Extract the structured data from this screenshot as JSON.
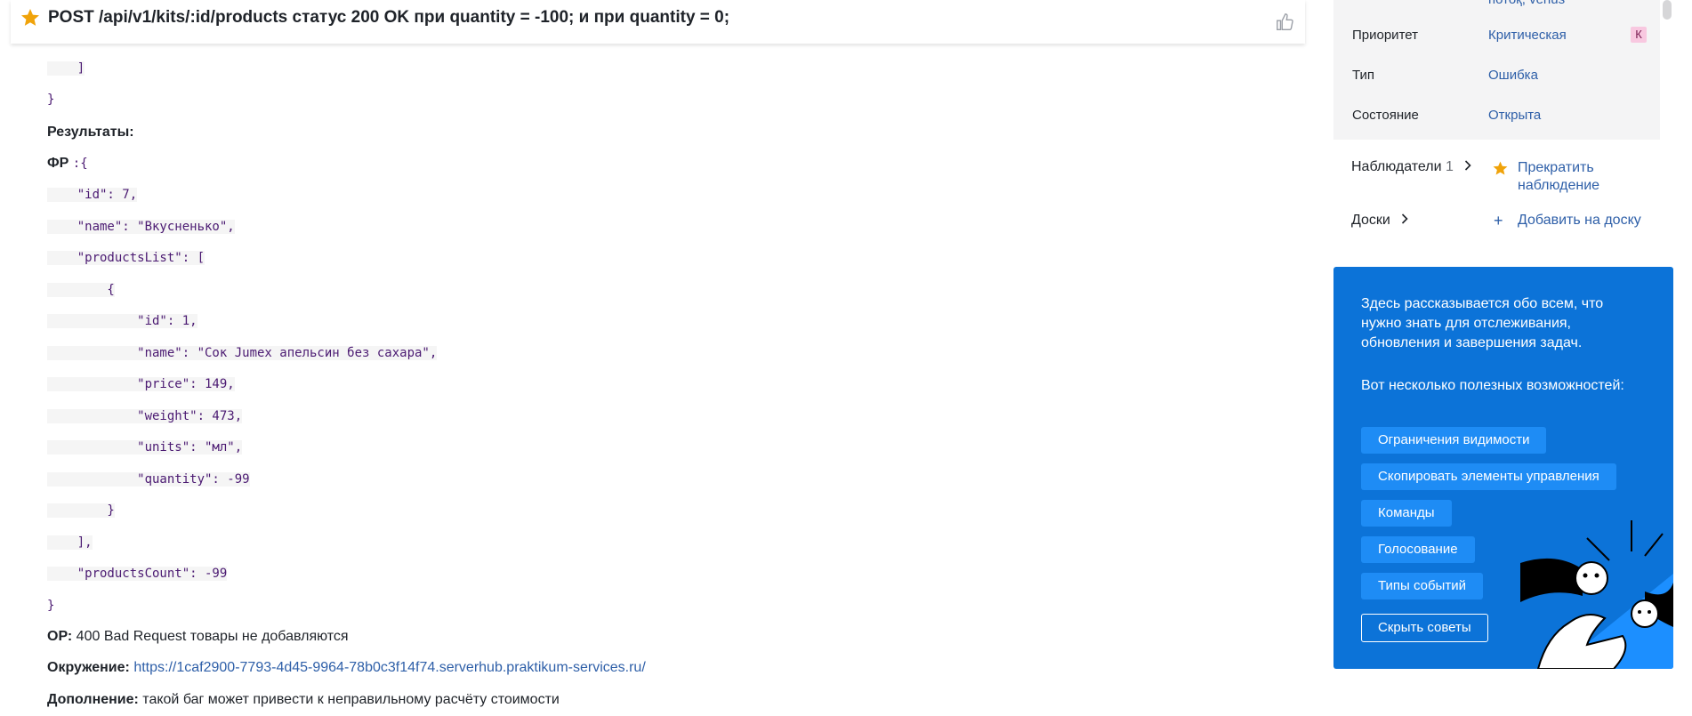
{
  "header": {
    "title": "POST /api/v1/kits/:id/products статус 200 OK при quantity = -100; и при quantity = 0;"
  },
  "description": {
    "code_top": [
      "    ]",
      "}"
    ],
    "results_label": "Результаты:",
    "fr_label": "ФР",
    "fr_open": ":{",
    "code_lines": [
      "    \"id\": 7,",
      "    \"name\": \"Вкусненько\",",
      "    \"productsList\": [",
      "        {",
      "            \"id\": 1,",
      "            \"name\": \"Сок Jumex апельсин без сахара\",",
      "            \"price\": 149,",
      "            \"weight\": 473,",
      "            \"units\": \"мл\",",
      "            \"quantity\": -99",
      "        }",
      "    ],",
      "    \"productsCount\": -99",
      "}"
    ],
    "or_label": "ОР:",
    "or_text": " 400 Bad Request товары не добавляются",
    "env_label": "Окружение:",
    "env_link": "https://1caf2900-7793-4d45-9964-78b0c3f14f74.serverhub.praktikum-services.ru/",
    "add_label": "Дополнение:",
    "add_text": " такой баг может привести к неправильному расчёту стоимости"
  },
  "properties": {
    "partial_value": "потоқ, venus",
    "priority_label": "Приоритет",
    "priority_value": "Критическая",
    "priority_badge": "К",
    "type_label": "Тип",
    "type_value": "Ошибка",
    "state_label": "Состояние",
    "state_value": "Открыта"
  },
  "watchers": {
    "label": "Наблюдатели",
    "count": "1",
    "action": "Прекратить наблюдение"
  },
  "boards": {
    "label": "Доски",
    "action": "Добавить на доску"
  },
  "tips": {
    "intro": "Здесь рассказывается обо всем, что нужно знать для отслеживания, обновления и завершения задач.",
    "subtitle": "Вот несколько полезных возможностей:",
    "buttons": [
      "Ограничения видимости",
      "Скопировать элементы управления",
      "Команды",
      "Голосование",
      "Типы событий"
    ],
    "hide": "Скрыть советы"
  },
  "colors": {
    "accent": "#0c73d8",
    "link": "#2e5fa8",
    "star": "#f0a30a",
    "code_text": "#4b1a72"
  }
}
